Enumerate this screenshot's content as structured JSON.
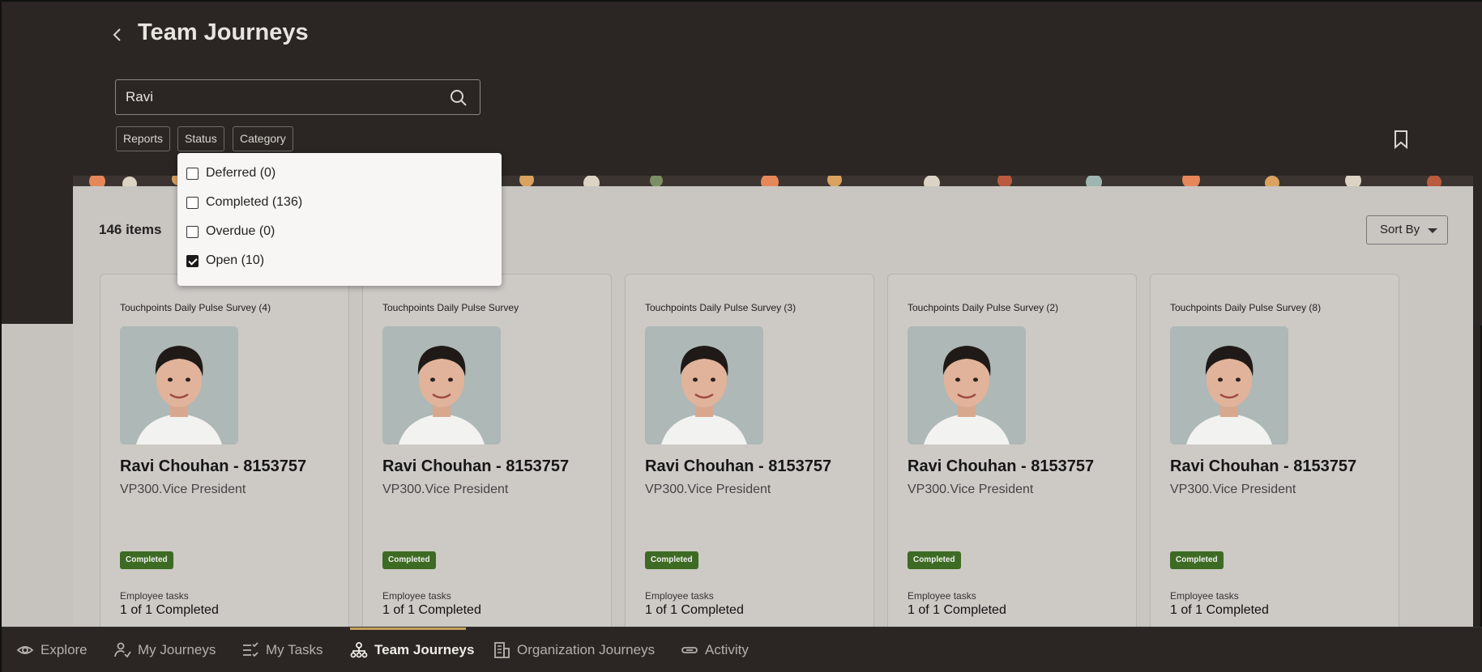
{
  "header": {
    "title": "Team Journeys",
    "search_value": "Ravi",
    "filters": [
      "Reports",
      "Status",
      "Category"
    ]
  },
  "status_dropdown": {
    "options": [
      {
        "label": "Deferred (0)",
        "checked": false
      },
      {
        "label": "Completed (136)",
        "checked": false
      },
      {
        "label": "Overdue (0)",
        "checked": false
      },
      {
        "label": "Open (10)",
        "checked": true
      }
    ]
  },
  "results": {
    "count_label": "146 items",
    "sort_label": "Sort By"
  },
  "cards": [
    {
      "journey": "Touchpoints Daily Pulse Survey (4)",
      "name": "Ravi Chouhan - 8153757",
      "role": "VP300.Vice President",
      "status": "Completed",
      "tasks_label": "Employee tasks",
      "tasks_value": "1 of 1 Completed"
    },
    {
      "journey": "Touchpoints Daily Pulse Survey",
      "name": "Ravi Chouhan - 8153757",
      "role": "VP300.Vice President",
      "status": "Completed",
      "tasks_label": "Employee tasks",
      "tasks_value": "1 of 1 Completed"
    },
    {
      "journey": "Touchpoints Daily Pulse Survey (3)",
      "name": "Ravi Chouhan - 8153757",
      "role": "VP300.Vice President",
      "status": "Completed",
      "tasks_label": "Employee tasks",
      "tasks_value": "1 of 1 Completed"
    },
    {
      "journey": "Touchpoints Daily Pulse Survey (2)",
      "name": "Ravi Chouhan - 8153757",
      "role": "VP300.Vice President",
      "status": "Completed",
      "tasks_label": "Employee tasks",
      "tasks_value": "1 of 1 Completed"
    },
    {
      "journey": "Touchpoints Daily Pulse Survey (8)",
      "name": "Ravi Chouhan - 8153757",
      "role": "VP300.Vice President",
      "status": "Completed",
      "tasks_label": "Employee tasks",
      "tasks_value": "1 of 1 Completed"
    }
  ],
  "bottom_nav": [
    {
      "label": "Explore",
      "icon": "eye-icon",
      "active": false
    },
    {
      "label": "My Journeys",
      "icon": "person-path-icon",
      "active": false
    },
    {
      "label": "My Tasks",
      "icon": "checklist-icon",
      "active": false
    },
    {
      "label": "Team Journeys",
      "icon": "org-chart-icon",
      "active": true
    },
    {
      "label": "Organization Journeys",
      "icon": "building-icon",
      "active": false
    },
    {
      "label": "Activity",
      "icon": "link-icon",
      "active": false
    }
  ],
  "colors": {
    "header_bg": "#2b2623",
    "content_bg": "#c9c6c2",
    "badge_green": "#3d6b24",
    "active_indicator": "#c8a15d"
  }
}
